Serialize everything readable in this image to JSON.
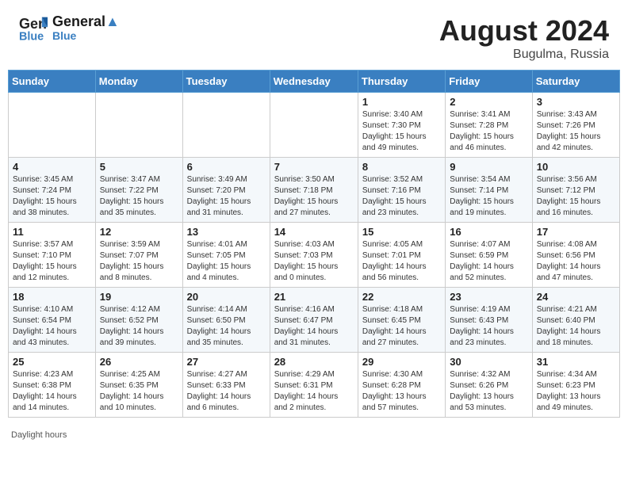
{
  "header": {
    "logo_line1": "General",
    "logo_line2": "Blue",
    "month_year": "August 2024",
    "location": "Bugulma, Russia"
  },
  "days_of_week": [
    "Sunday",
    "Monday",
    "Tuesday",
    "Wednesday",
    "Thursday",
    "Friday",
    "Saturday"
  ],
  "weeks": [
    [
      {
        "day": "",
        "info": ""
      },
      {
        "day": "",
        "info": ""
      },
      {
        "day": "",
        "info": ""
      },
      {
        "day": "",
        "info": ""
      },
      {
        "day": "1",
        "info": "Sunrise: 3:40 AM\nSunset: 7:30 PM\nDaylight: 15 hours\nand 49 minutes."
      },
      {
        "day": "2",
        "info": "Sunrise: 3:41 AM\nSunset: 7:28 PM\nDaylight: 15 hours\nand 46 minutes."
      },
      {
        "day": "3",
        "info": "Sunrise: 3:43 AM\nSunset: 7:26 PM\nDaylight: 15 hours\nand 42 minutes."
      }
    ],
    [
      {
        "day": "4",
        "info": "Sunrise: 3:45 AM\nSunset: 7:24 PM\nDaylight: 15 hours\nand 38 minutes."
      },
      {
        "day": "5",
        "info": "Sunrise: 3:47 AM\nSunset: 7:22 PM\nDaylight: 15 hours\nand 35 minutes."
      },
      {
        "day": "6",
        "info": "Sunrise: 3:49 AM\nSunset: 7:20 PM\nDaylight: 15 hours\nand 31 minutes."
      },
      {
        "day": "7",
        "info": "Sunrise: 3:50 AM\nSunset: 7:18 PM\nDaylight: 15 hours\nand 27 minutes."
      },
      {
        "day": "8",
        "info": "Sunrise: 3:52 AM\nSunset: 7:16 PM\nDaylight: 15 hours\nand 23 minutes."
      },
      {
        "day": "9",
        "info": "Sunrise: 3:54 AM\nSunset: 7:14 PM\nDaylight: 15 hours\nand 19 minutes."
      },
      {
        "day": "10",
        "info": "Sunrise: 3:56 AM\nSunset: 7:12 PM\nDaylight: 15 hours\nand 16 minutes."
      }
    ],
    [
      {
        "day": "11",
        "info": "Sunrise: 3:57 AM\nSunset: 7:10 PM\nDaylight: 15 hours\nand 12 minutes."
      },
      {
        "day": "12",
        "info": "Sunrise: 3:59 AM\nSunset: 7:07 PM\nDaylight: 15 hours\nand 8 minutes."
      },
      {
        "day": "13",
        "info": "Sunrise: 4:01 AM\nSunset: 7:05 PM\nDaylight: 15 hours\nand 4 minutes."
      },
      {
        "day": "14",
        "info": "Sunrise: 4:03 AM\nSunset: 7:03 PM\nDaylight: 15 hours\nand 0 minutes."
      },
      {
        "day": "15",
        "info": "Sunrise: 4:05 AM\nSunset: 7:01 PM\nDaylight: 14 hours\nand 56 minutes."
      },
      {
        "day": "16",
        "info": "Sunrise: 4:07 AM\nSunset: 6:59 PM\nDaylight: 14 hours\nand 52 minutes."
      },
      {
        "day": "17",
        "info": "Sunrise: 4:08 AM\nSunset: 6:56 PM\nDaylight: 14 hours\nand 47 minutes."
      }
    ],
    [
      {
        "day": "18",
        "info": "Sunrise: 4:10 AM\nSunset: 6:54 PM\nDaylight: 14 hours\nand 43 minutes."
      },
      {
        "day": "19",
        "info": "Sunrise: 4:12 AM\nSunset: 6:52 PM\nDaylight: 14 hours\nand 39 minutes."
      },
      {
        "day": "20",
        "info": "Sunrise: 4:14 AM\nSunset: 6:50 PM\nDaylight: 14 hours\nand 35 minutes."
      },
      {
        "day": "21",
        "info": "Sunrise: 4:16 AM\nSunset: 6:47 PM\nDaylight: 14 hours\nand 31 minutes."
      },
      {
        "day": "22",
        "info": "Sunrise: 4:18 AM\nSunset: 6:45 PM\nDaylight: 14 hours\nand 27 minutes."
      },
      {
        "day": "23",
        "info": "Sunrise: 4:19 AM\nSunset: 6:43 PM\nDaylight: 14 hours\nand 23 minutes."
      },
      {
        "day": "24",
        "info": "Sunrise: 4:21 AM\nSunset: 6:40 PM\nDaylight: 14 hours\nand 18 minutes."
      }
    ],
    [
      {
        "day": "25",
        "info": "Sunrise: 4:23 AM\nSunset: 6:38 PM\nDaylight: 14 hours\nand 14 minutes."
      },
      {
        "day": "26",
        "info": "Sunrise: 4:25 AM\nSunset: 6:35 PM\nDaylight: 14 hours\nand 10 minutes."
      },
      {
        "day": "27",
        "info": "Sunrise: 4:27 AM\nSunset: 6:33 PM\nDaylight: 14 hours\nand 6 minutes."
      },
      {
        "day": "28",
        "info": "Sunrise: 4:29 AM\nSunset: 6:31 PM\nDaylight: 14 hours\nand 2 minutes."
      },
      {
        "day": "29",
        "info": "Sunrise: 4:30 AM\nSunset: 6:28 PM\nDaylight: 13 hours\nand 57 minutes."
      },
      {
        "day": "30",
        "info": "Sunrise: 4:32 AM\nSunset: 6:26 PM\nDaylight: 13 hours\nand 53 minutes."
      },
      {
        "day": "31",
        "info": "Sunrise: 4:34 AM\nSunset: 6:23 PM\nDaylight: 13 hours\nand 49 minutes."
      }
    ]
  ],
  "footer": {
    "daylight_label": "Daylight hours"
  }
}
